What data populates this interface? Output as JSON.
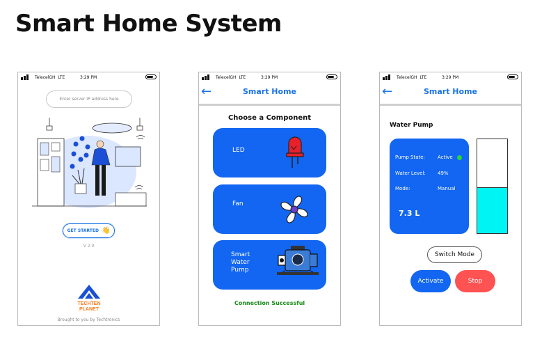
{
  "page_title": "Smart Home System",
  "status_bar": {
    "carrier": "TelecelGH",
    "network": "LTE",
    "time": "3:29 PM"
  },
  "screen1": {
    "ip_placeholder": "Enter server IP address here",
    "get_started_label": "GET STARTED",
    "get_started_emoji": "👋",
    "version": "V 2.0",
    "logo_text_1": "TECHTEN",
    "logo_text_2": "PLANET",
    "brought_by": "Brought to you by Techtronics"
  },
  "screen2": {
    "back_icon": "←",
    "header_title": "Smart Home",
    "choose_label": "Choose a Component",
    "components": [
      {
        "label": "LED",
        "icon": "led-icon"
      },
      {
        "label": "Fan",
        "icon": "fan-icon"
      },
      {
        "label_lines": [
          "Smart",
          "Water",
          "Pump"
        ],
        "icon": "water-pump-icon"
      }
    ],
    "connection_status": "Connection Successful"
  },
  "screen3": {
    "back_icon": "←",
    "header_title": "Smart Home",
    "section_title": "Water Pump",
    "pump_state_label": "Pump State:",
    "pump_state_value": "Active",
    "water_level_label": "Water Level:",
    "water_level_value": "49%",
    "water_level_fraction": 0.49,
    "mode_label": "Mode:",
    "mode_value": "Manual",
    "liters": "7.3 L",
    "switch_mode_label": "Switch Mode",
    "activate_label": "Activate",
    "stop_label": "Stop"
  },
  "colors": {
    "primary": "#1266f1",
    "header_text": "#1a73e8",
    "active_dot": "#27d63a",
    "tank_water": "#00f4f4",
    "stop": "#ff5252",
    "success": "#1b8a1b"
  }
}
